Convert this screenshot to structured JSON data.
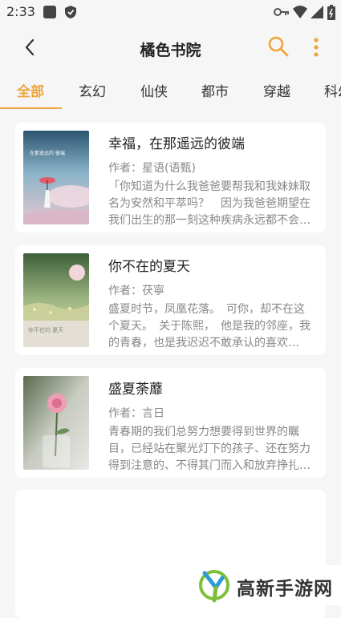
{
  "status_bar": {
    "time": "2:33"
  },
  "header": {
    "title": "橘色书院"
  },
  "tabs": [
    {
      "label": "全部",
      "active": true
    },
    {
      "label": "玄幻",
      "active": false
    },
    {
      "label": "仙侠",
      "active": false
    },
    {
      "label": "都市",
      "active": false
    },
    {
      "label": "穿越",
      "active": false
    },
    {
      "label": "科幻",
      "active": false
    }
  ],
  "books": [
    {
      "title": "幸福，在那遥远的彼端",
      "author": "作者：星语(语甄)",
      "description": "「你知道为什么我爸爸要帮我和我妹妹取名为安然和平萃吗？　因为我爸爸期望在我们出生的那一刻这种疾病永远都不会…",
      "cover_text": "在那遥远的 彼端"
    },
    {
      "title": "你不在的夏天",
      "author": "作者：茯寧",
      "description": "盛夏时节，凤凰花落。　可你，却不在这个夏天。　关于陈熙，　他是我的邻座，我的青春，也是我迟迟不敢承认的喜欢…",
      "cover_text": "你不在的 夏天"
    },
    {
      "title": "盛夏荼蘼",
      "author": "作者：言日",
      "description": "青春期的我们总努力想要得到世界的瞩目，已经站在聚光灯下的孩子、还在努力得到注意的、不得其门而入和放弃挣扎…",
      "cover_text": ""
    }
  ],
  "watermark": {
    "text": "高新手游网"
  },
  "colors": {
    "accent": "#f0a43a",
    "background": "#f6f6f6"
  }
}
